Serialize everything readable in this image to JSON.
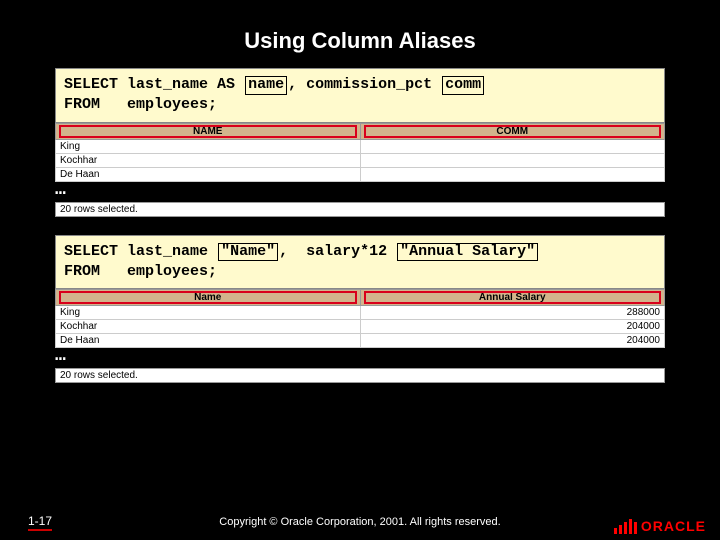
{
  "title": "Using Column Aliases",
  "sql1": {
    "kw_select": "SELECT",
    "col1": "last_name AS",
    "alias1": "name",
    "comma": ",",
    "col2": "commission_pct",
    "alias2": "comm",
    "kw_from": "FROM",
    "table": "employees;"
  },
  "result1": {
    "headers": [
      "NAME",
      "COMM"
    ],
    "rows": [
      [
        "King",
        ""
      ],
      [
        "Kochhar",
        ""
      ],
      [
        "De Haan",
        ""
      ]
    ],
    "ellipsis": "…",
    "status": "20 rows selected."
  },
  "sql2": {
    "kw_select": "SELECT",
    "col1": "last_name",
    "alias1": "\"Name\"",
    "comma": ",",
    "col2": "salary*12",
    "alias2": "\"Annual Salary\"",
    "kw_from": "FROM",
    "table": "employees;"
  },
  "result2": {
    "headers": [
      "Name",
      "Annual Salary"
    ],
    "rows": [
      [
        "King",
        "288000"
      ],
      [
        "Kochhar",
        "204000"
      ],
      [
        "De Haan",
        "204000"
      ]
    ],
    "ellipsis": "…",
    "status": "20 rows selected."
  },
  "footer": {
    "page": "1-17",
    "copyright": "Copyright © Oracle Corporation, 2001. All rights reserved.",
    "logo_text": "ORACLE"
  }
}
